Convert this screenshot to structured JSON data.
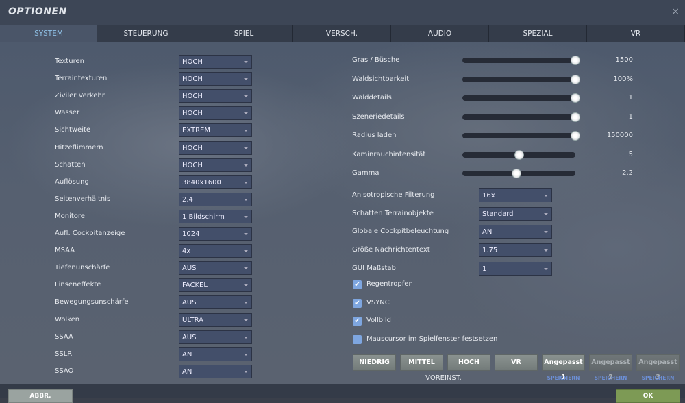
{
  "title": "OPTIONEN",
  "close_icon": "×",
  "tabs": [
    {
      "label": "SYSTEM",
      "active": true
    },
    {
      "label": "STEUERUNG"
    },
    {
      "label": "SPIEL"
    },
    {
      "label": "VERSCH."
    },
    {
      "label": "AUDIO"
    },
    {
      "label": "SPEZIAL"
    },
    {
      "label": "VR"
    }
  ],
  "left_settings": [
    {
      "label": "Texturen",
      "value": "HOCH"
    },
    {
      "label": "Terraintexturen",
      "value": "HOCH"
    },
    {
      "label": "Ziviler Verkehr",
      "value": "HOCH"
    },
    {
      "label": "Wasser",
      "value": "HOCH"
    },
    {
      "label": "Sichtweite",
      "value": "EXTREM"
    },
    {
      "label": "Hitzeflimmern",
      "value": "HOCH"
    },
    {
      "label": "Schatten",
      "value": "HOCH"
    },
    {
      "label": "Auflösung",
      "value": "3840x1600"
    },
    {
      "label": "Seitenverhältnis",
      "value": "2.4"
    },
    {
      "label": "Monitore",
      "value": "1 Bildschirm"
    },
    {
      "label": "Aufl. Cockpitanzeige",
      "value": "1024"
    },
    {
      "label": "MSAA",
      "value": "4x"
    },
    {
      "label": "Tiefenunschärfe",
      "value": "AUS"
    },
    {
      "label": "Linseneffekte",
      "value": "FACKEL"
    },
    {
      "label": "Bewegungsunschärfe",
      "value": "AUS"
    },
    {
      "label": "Wolken",
      "value": "ULTRA"
    },
    {
      "label": "SSAA",
      "value": "AUS"
    },
    {
      "label": "SSLR",
      "value": "AN"
    },
    {
      "label": "SSAO",
      "value": "AN"
    }
  ],
  "sliders": [
    {
      "label": "Gras / Büsche",
      "value": "1500",
      "fraction": 1.0
    },
    {
      "label": "Waldsichtbarkeit",
      "value": "100%",
      "fraction": 1.0
    },
    {
      "label": "Walddetails",
      "value": "1",
      "fraction": 1.0
    },
    {
      "label": "Szeneriedetails",
      "value": "1",
      "fraction": 1.0
    },
    {
      "label": "Radius laden",
      "value": "150000",
      "fraction": 1.0
    },
    {
      "label": "Kaminrauchintensität",
      "value": "5",
      "fraction": 0.5
    },
    {
      "label": "Gamma",
      "value": "2.2",
      "fraction": 0.48
    }
  ],
  "right_settings": [
    {
      "label": "Anisotropische Filterung",
      "value": "16x"
    },
    {
      "label": "Schatten Terrainobjekte",
      "value": "Standard"
    },
    {
      "label": "Globale Cockpitbeleuchtung",
      "value": "AN"
    },
    {
      "label": "Größe Nachrichtentext",
      "value": "1.75"
    },
    {
      "label": "GUI Maßstab",
      "value": "1"
    }
  ],
  "checkboxes": [
    {
      "label": "Regentropfen",
      "checked": true
    },
    {
      "label": "VSYNC",
      "checked": true
    },
    {
      "label": "Vollbild",
      "checked": true
    },
    {
      "label": "Mauscursor im Spielfenster festsetzen",
      "checked": false
    }
  ],
  "presets": [
    {
      "label": "NIEDRIG"
    },
    {
      "label": "MITTEL"
    },
    {
      "label": "HOCH"
    },
    {
      "label": "VR"
    },
    {
      "label": "Angepasst 1",
      "save": "SPEICHERN"
    },
    {
      "label": "Angepasst 2",
      "save": "SPEICHERN",
      "dim": true
    },
    {
      "label": "Angepasst 3",
      "save": "SPEICHERN",
      "dim": true
    }
  ],
  "presets_caption": "VOREINST.",
  "cancel_label": "ABBR.",
  "ok_label": "OK",
  "colors": {
    "active_tab": "#8fc1e6",
    "dropdown": "#434f6a",
    "ok": "#7d9a55",
    "save_link": "#6c8fd6"
  }
}
